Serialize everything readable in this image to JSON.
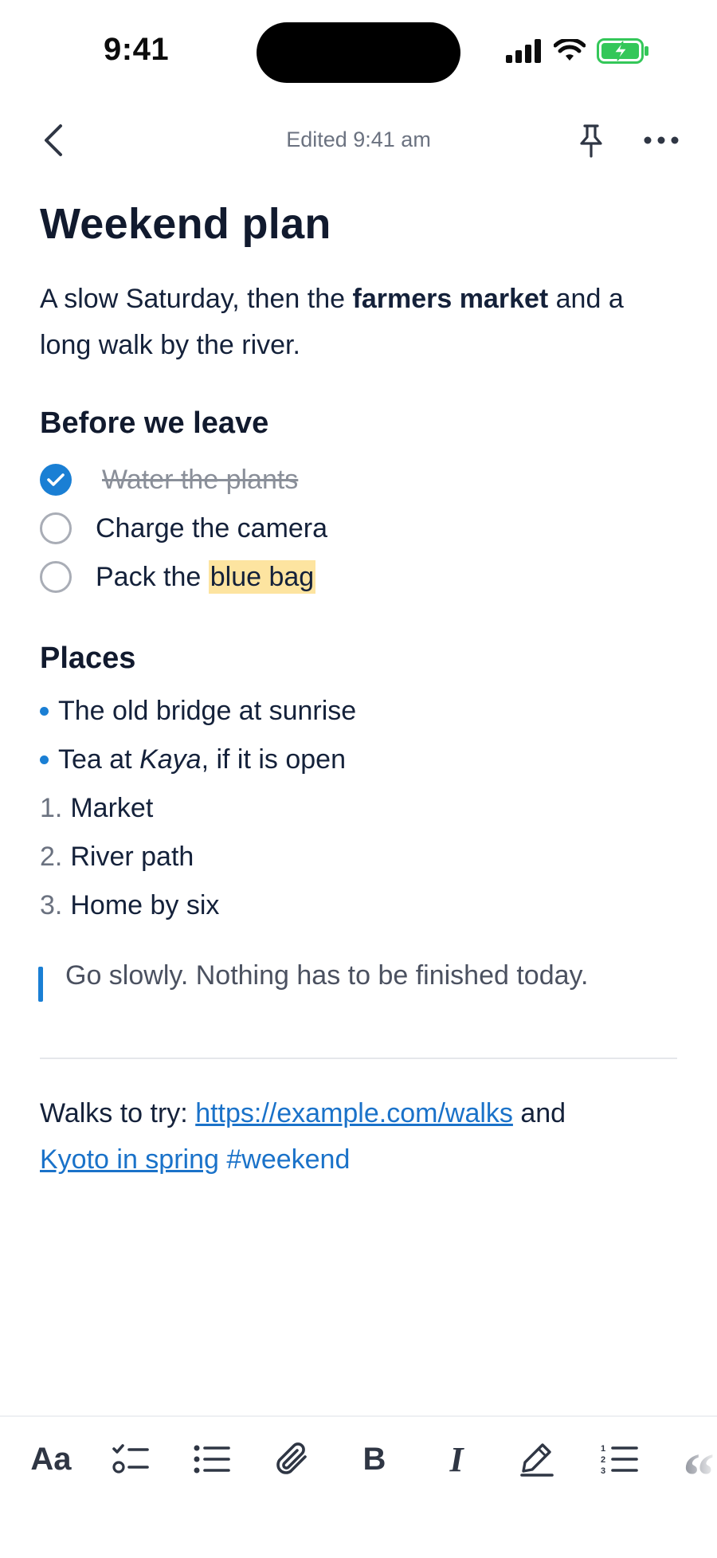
{
  "status_bar": {
    "time": "9:41"
  },
  "nav": {
    "edited": "Edited 9:41 am"
  },
  "note": {
    "title": "Weekend plan",
    "intro": {
      "before": "A slow Saturday, then the ",
      "bold": "farmers market",
      "after": " and a long walk by the river."
    },
    "checklist": {
      "heading": "Before we leave",
      "items": [
        {
          "label": "Water the plants",
          "done": true
        },
        {
          "label": "Charge the camera",
          "done": false
        },
        {
          "label_before": "Pack the ",
          "highlight": "blue bag",
          "done": false
        }
      ]
    },
    "places": {
      "heading": "Places",
      "bullets": [
        {
          "text": "The old bridge at sunrise"
        },
        {
          "before": "Tea at ",
          "italic": "Kaya",
          "after": ", if it is open"
        }
      ],
      "numbered": [
        {
          "num": "1.",
          "text": "Market"
        },
        {
          "num": "2.",
          "text": "River path"
        },
        {
          "num": "3.",
          "text": "Home by six"
        }
      ]
    },
    "quote": "Go slowly. Nothing has to be finished today.",
    "links": {
      "prefix": "Walks to try: ",
      "url": "https://example.com/walks",
      "middle": " and",
      "link2": "Kyoto in spring",
      "tag": "#weekend"
    }
  },
  "toolbar": {
    "text_style": "Aa",
    "bold": "B",
    "italic": "I",
    "quote": "“",
    "icons": [
      "text-style-icon",
      "checklist-icon",
      "bullet-list-icon",
      "attachment-icon",
      "bold-icon",
      "italic-icon",
      "highlight-icon",
      "numbered-list-icon",
      "quote-icon"
    ]
  },
  "colors": {
    "accent": "#1a7fd4",
    "link": "#1a72c9",
    "highlight": "#fde4a0",
    "battery": "#34c759"
  }
}
